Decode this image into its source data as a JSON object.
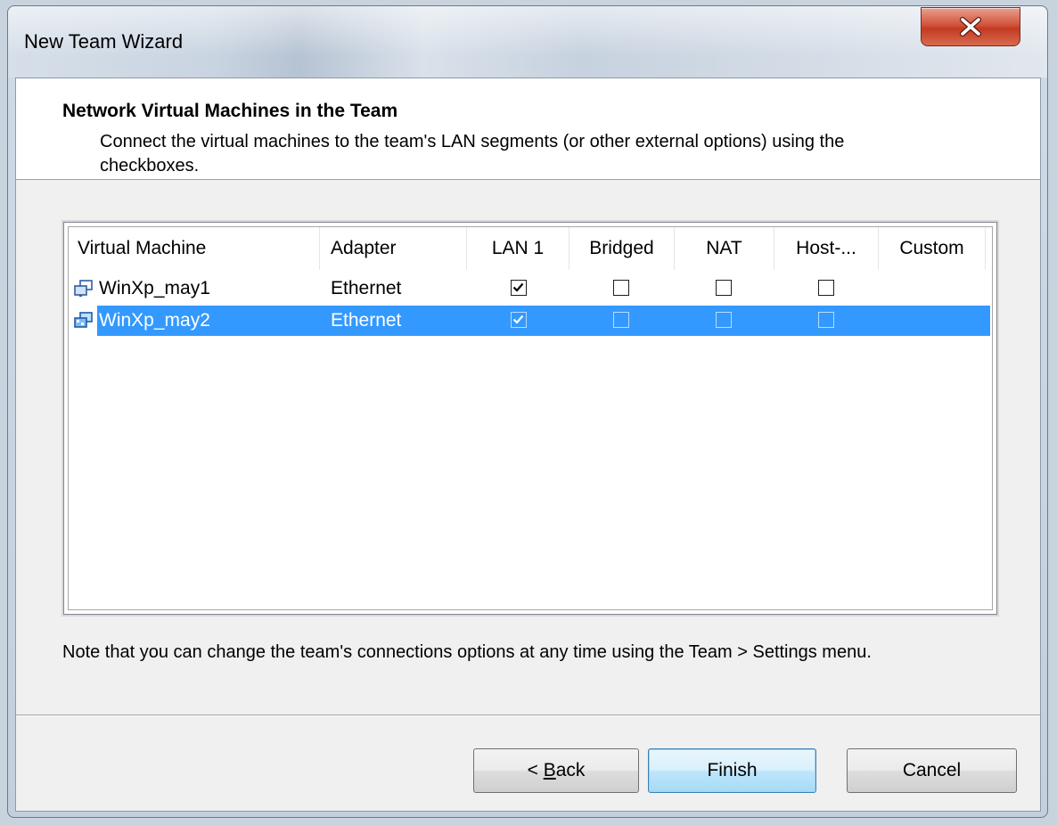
{
  "window": {
    "title": "New Team Wizard"
  },
  "header": {
    "title": "Network Virtual Machines in the Team",
    "subtitle": "Connect the virtual machines to the team's LAN segments (or other external options) using the checkboxes."
  },
  "table": {
    "columns": [
      "Virtual Machine",
      "Adapter",
      "LAN 1",
      "Bridged",
      "NAT",
      "Host-...",
      "Custom"
    ],
    "rows": [
      {
        "vm": "WinXp_may1",
        "adapter": "Ethernet",
        "lan1": true,
        "bridged": false,
        "nat": false,
        "host": false,
        "selected": false
      },
      {
        "vm": "WinXp_may2",
        "adapter": "Ethernet",
        "lan1": true,
        "bridged": false,
        "nat": false,
        "host": false,
        "selected": true
      }
    ]
  },
  "note": "Note that you can change the team's connections options at any time using the Team > Settings menu.",
  "buttons": {
    "back_prefix": "< ",
    "back_mnemonic": "B",
    "back_rest": "ack",
    "finish": "Finish",
    "cancel": "Cancel"
  },
  "colors": {
    "selection": "#3399ff",
    "close_button": "#c23b22"
  }
}
